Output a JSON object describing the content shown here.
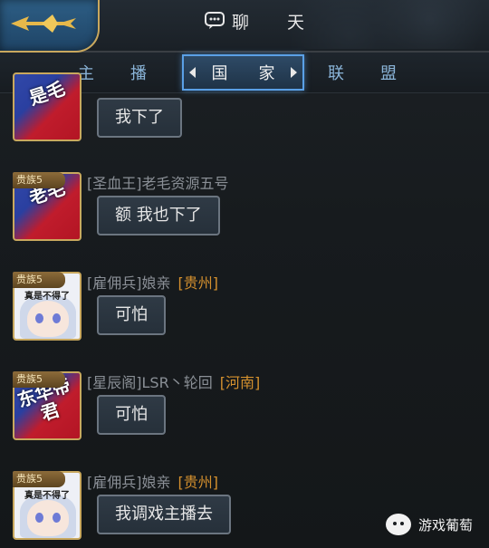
{
  "header": {
    "title": "聊 天",
    "chat_icon": "chat-bubble-icon",
    "back_icon": "winged-arrow-icon"
  },
  "tabs": [
    {
      "label": "主播"
    },
    {
      "label": "国家"
    },
    {
      "label": "联盟"
    }
  ],
  "messages": [
    {
      "bubble": "我下了"
    },
    {
      "badge": "贵族5",
      "guild": "[圣血王]",
      "name": "老毛资源五号",
      "region": "",
      "bubble": "额  我也下了"
    },
    {
      "badge": "贵族5",
      "guild": "[雇佣兵]",
      "name": "娘亲",
      "region": "[贵州]",
      "bubble": "可怕"
    },
    {
      "badge": "贵族5",
      "guild": "[星辰阁]",
      "name": "LSR丶轮回",
      "region": "[河南]",
      "bubble": "可怕"
    },
    {
      "badge": "贵族5",
      "guild": "[雇佣兵]",
      "name": "娘亲",
      "region": "[贵州]",
      "bubble": "我调戏主播去"
    }
  ],
  "avatars": {
    "red1": "是毛",
    "red2": "老毛",
    "red3": "东华帝君",
    "anime_caption": "真是不得了"
  },
  "watermark": {
    "text": "游戏葡萄",
    "icon": "wechat-icon"
  }
}
